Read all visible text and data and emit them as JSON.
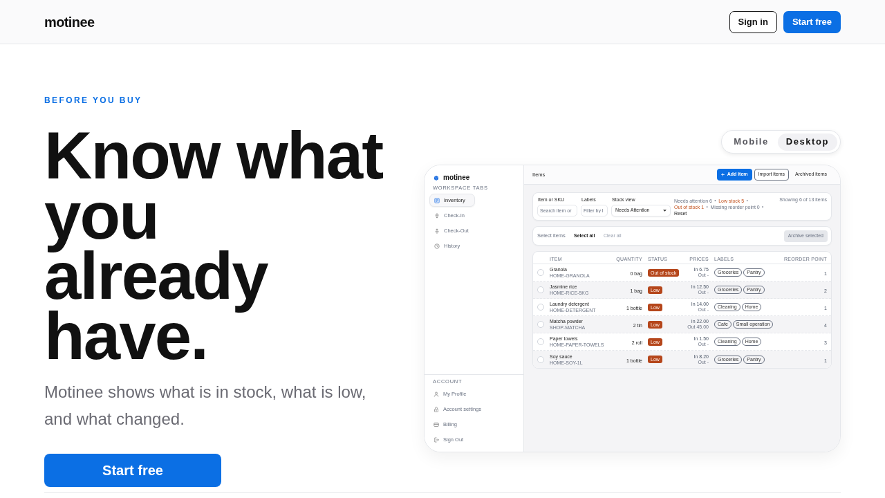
{
  "header": {
    "logo": "motinee",
    "buttons": [
      {
        "label": "Sign in",
        "kind": "outline"
      },
      {
        "label": "Start free",
        "kind": "primary"
      }
    ]
  },
  "hero": {
    "eyebrow": "BEFORE YOU BUY",
    "headline": "Know what you already have.",
    "subtitle": "Motinee shows what is in stock, what is low, and what changed.",
    "cta": "Start free"
  },
  "view_toggle": [
    {
      "label": "Mobile",
      "selected": false
    },
    {
      "label": "Desktop",
      "selected": true
    }
  ],
  "app": {
    "sidebar": {
      "logo": "motinee",
      "section_title": "WORKSPACE TABS",
      "items": [
        {
          "label": "Inventory",
          "selected": true
        },
        {
          "label": "Check-In",
          "selected": false
        },
        {
          "label": "Check-Out",
          "selected": false
        },
        {
          "label": "History",
          "selected": false
        }
      ],
      "account_title": "ACCOUNT",
      "account_items": [
        "My Profile",
        "Account settings",
        "Billing",
        "Sign Out"
      ]
    },
    "toolbar": {
      "title": "Items",
      "buttons": [
        {
          "label": "Add item",
          "kind": "primary"
        },
        {
          "label": "Import items",
          "kind": "outline"
        },
        {
          "label": "Archived items",
          "kind": "plain"
        }
      ]
    },
    "filters": {
      "fields": [
        {
          "label": "Item or SKU",
          "placeholder": "Search item or",
          "kind": "text"
        },
        {
          "label": "Labels",
          "placeholder": "Filter by l",
          "kind": "text"
        },
        {
          "label": "Stock view",
          "value": "Needs Attention",
          "kind": "select"
        }
      ],
      "summary": [
        {
          "text": "Needs attention 6",
          "kind": "count"
        },
        {
          "text": "Low stock 5",
          "kind": "alert"
        },
        {
          "text": "Out of stock 1",
          "kind": "alert"
        },
        {
          "text": "Missing reorder point 0",
          "kind": "count"
        },
        {
          "text": "Reset",
          "kind": "link"
        }
      ],
      "separator": "·",
      "result_count": "Showing 6 of 13 items"
    },
    "selection": {
      "label": "Select items",
      "actions": [
        {
          "label": "Select all",
          "disabled": false
        },
        {
          "label": "Clear all",
          "disabled": true
        }
      ],
      "archive": {
        "label": "Archive selected",
        "disabled": true
      }
    },
    "table": {
      "columns": [
        "ITEM",
        "QUANTITY",
        "STATUS",
        "PRICES",
        "LABELS",
        "REORDER POINT"
      ],
      "rows": [
        {
          "checked": false,
          "name": "Granola",
          "sku": "HOME-GRANOLA",
          "quantity": "0 bag",
          "status": "Out of stock",
          "price_in": "In 6.75",
          "price_out": "Out -",
          "labels": [
            "Groceries",
            "Pantry"
          ],
          "reorder_point": "1"
        },
        {
          "checked": false,
          "name": "Jasmine rice",
          "sku": "HOME-RICE-5KG",
          "quantity": "1 bag",
          "status": "Low",
          "price_in": "In 12.50",
          "price_out": "Out -",
          "labels": [
            "Groceries",
            "Pantry"
          ],
          "reorder_point": "2"
        },
        {
          "checked": false,
          "name": "Laundry detergent",
          "sku": "HOME-DETERGENT",
          "quantity": "1 bottle",
          "status": "Low",
          "price_in": "In 14.00",
          "price_out": "Out -",
          "labels": [
            "Cleaning",
            "Home"
          ],
          "reorder_point": "1"
        },
        {
          "checked": false,
          "name": "Matcha powder",
          "sku": "SHOP-MATCHA",
          "quantity": "2 tin",
          "status": "Low",
          "price_in": "In 22.00",
          "price_out": "Out 45.00",
          "labels": [
            "Cafe",
            "Small operation"
          ],
          "reorder_point": "4"
        },
        {
          "checked": false,
          "name": "Paper towels",
          "sku": "HOME-PAPER-TOWELS",
          "quantity": "2 roll",
          "status": "Low",
          "price_in": "In 1.50",
          "price_out": "Out -",
          "labels": [
            "Cleaning",
            "Home"
          ],
          "reorder_point": "3"
        },
        {
          "checked": false,
          "name": "Soy sauce",
          "sku": "HOME-SOY-1L",
          "quantity": "1 bottle",
          "status": "Low",
          "price_in": "In 8.20",
          "price_out": "Out -",
          "labels": [
            "Groceries",
            "Pantry"
          ],
          "reorder_point": "1"
        }
      ]
    }
  }
}
